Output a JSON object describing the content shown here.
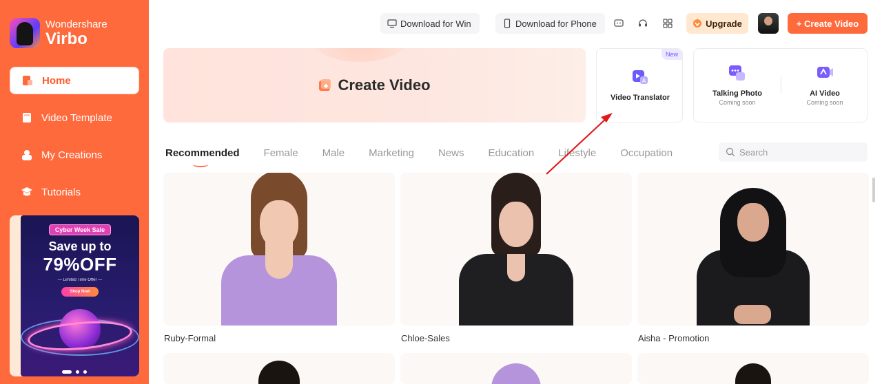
{
  "brand": {
    "company": "Wondershare",
    "product": "Virbo"
  },
  "sidebar": {
    "items": [
      {
        "label": "Home",
        "icon": "home-icon"
      },
      {
        "label": "Video Template",
        "icon": "template-icon"
      },
      {
        "label": "My Creations",
        "icon": "creations-icon"
      },
      {
        "label": "Tutorials",
        "icon": "tutorials-icon"
      }
    ],
    "promo": {
      "tag": "Cyber Week Sale",
      "headline": "Save up to",
      "discount": "79%OFF",
      "limited": "Limited Time Offer",
      "button": "Shop Now",
      "dots": 3
    }
  },
  "header": {
    "download_win": "Download for Win",
    "download_phone": "Download for Phone",
    "upgrade": "Upgrade",
    "create_video": "+ Create Video"
  },
  "main": {
    "create_card": "Create Video",
    "tools": [
      {
        "title": "Video Translator",
        "sub": "",
        "badge": "New"
      },
      {
        "title": "Talking Photo",
        "sub": "Coming soon"
      },
      {
        "title": "AI Video",
        "sub": "Coming soon"
      }
    ],
    "tabs": [
      "Recommended",
      "Female",
      "Male",
      "Marketing",
      "News",
      "Education",
      "Lifestyle",
      "Occupation"
    ],
    "active_tab": "Recommended",
    "search": {
      "placeholder": "Search"
    },
    "avatars": [
      {
        "name": "Ruby-Formal"
      },
      {
        "name": "Chloe-Sales"
      },
      {
        "name": "Aisha - Promotion"
      }
    ]
  },
  "colors": {
    "accent": "#ff6a3d",
    "annotation": "#e0191b"
  }
}
